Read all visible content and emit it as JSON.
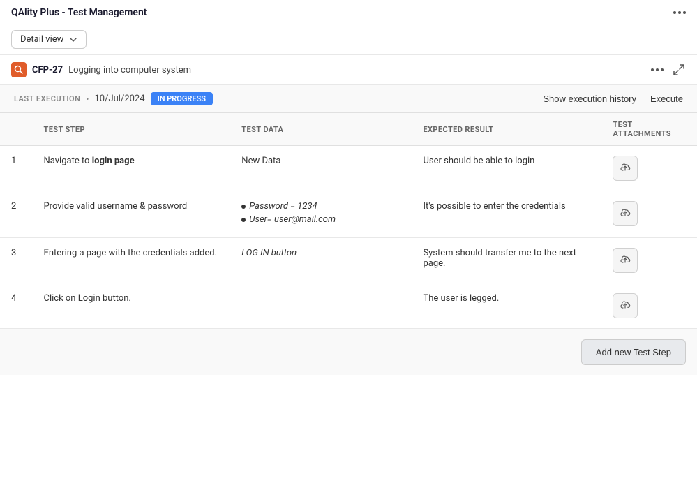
{
  "app": {
    "title": "QAlity Plus - Test Management"
  },
  "toolbar": {
    "view_label": "Detail view"
  },
  "issue": {
    "id": "CFP-27",
    "title": "Logging into computer system"
  },
  "execution": {
    "last_execution_label": "LAST EXECUTION",
    "date": "10/Jul/2024",
    "status": "IN PROGRESS",
    "show_history_label": "Show execution history",
    "execute_label": "Execute"
  },
  "table": {
    "columns": {
      "step": "TEST STEP",
      "data": "TEST DATA",
      "result": "EXPECTED RESULT",
      "attachments": "TEST ATTACHMENTS"
    },
    "rows": [
      {
        "num": "1",
        "step": "Navigate to login page",
        "step_bold_part": "login page",
        "data_type": "plain",
        "data": "New Data",
        "result": "User should be able to login",
        "attach_label": "upload"
      },
      {
        "num": "2",
        "step": "Provide valid username & password",
        "step_bold_part": "",
        "data_type": "bullets",
        "data_bullets": [
          "Password = 1234",
          "User= user@mail.com"
        ],
        "result": "It's possible to enter the credentials",
        "attach_label": "upload"
      },
      {
        "num": "3",
        "step": "Entering a page with the credentials added.",
        "step_bold_part": "",
        "data_type": "italic",
        "data": "LOG IN button",
        "result": "System should transfer me to the next page.",
        "attach_label": "upload"
      },
      {
        "num": "4",
        "step": "Click on Login button.",
        "step_bold_part": "",
        "data_type": "plain",
        "data": "",
        "result": "The user is legged.",
        "attach_label": "upload"
      }
    ]
  },
  "footer": {
    "add_step_label": "Add new Test Step"
  }
}
